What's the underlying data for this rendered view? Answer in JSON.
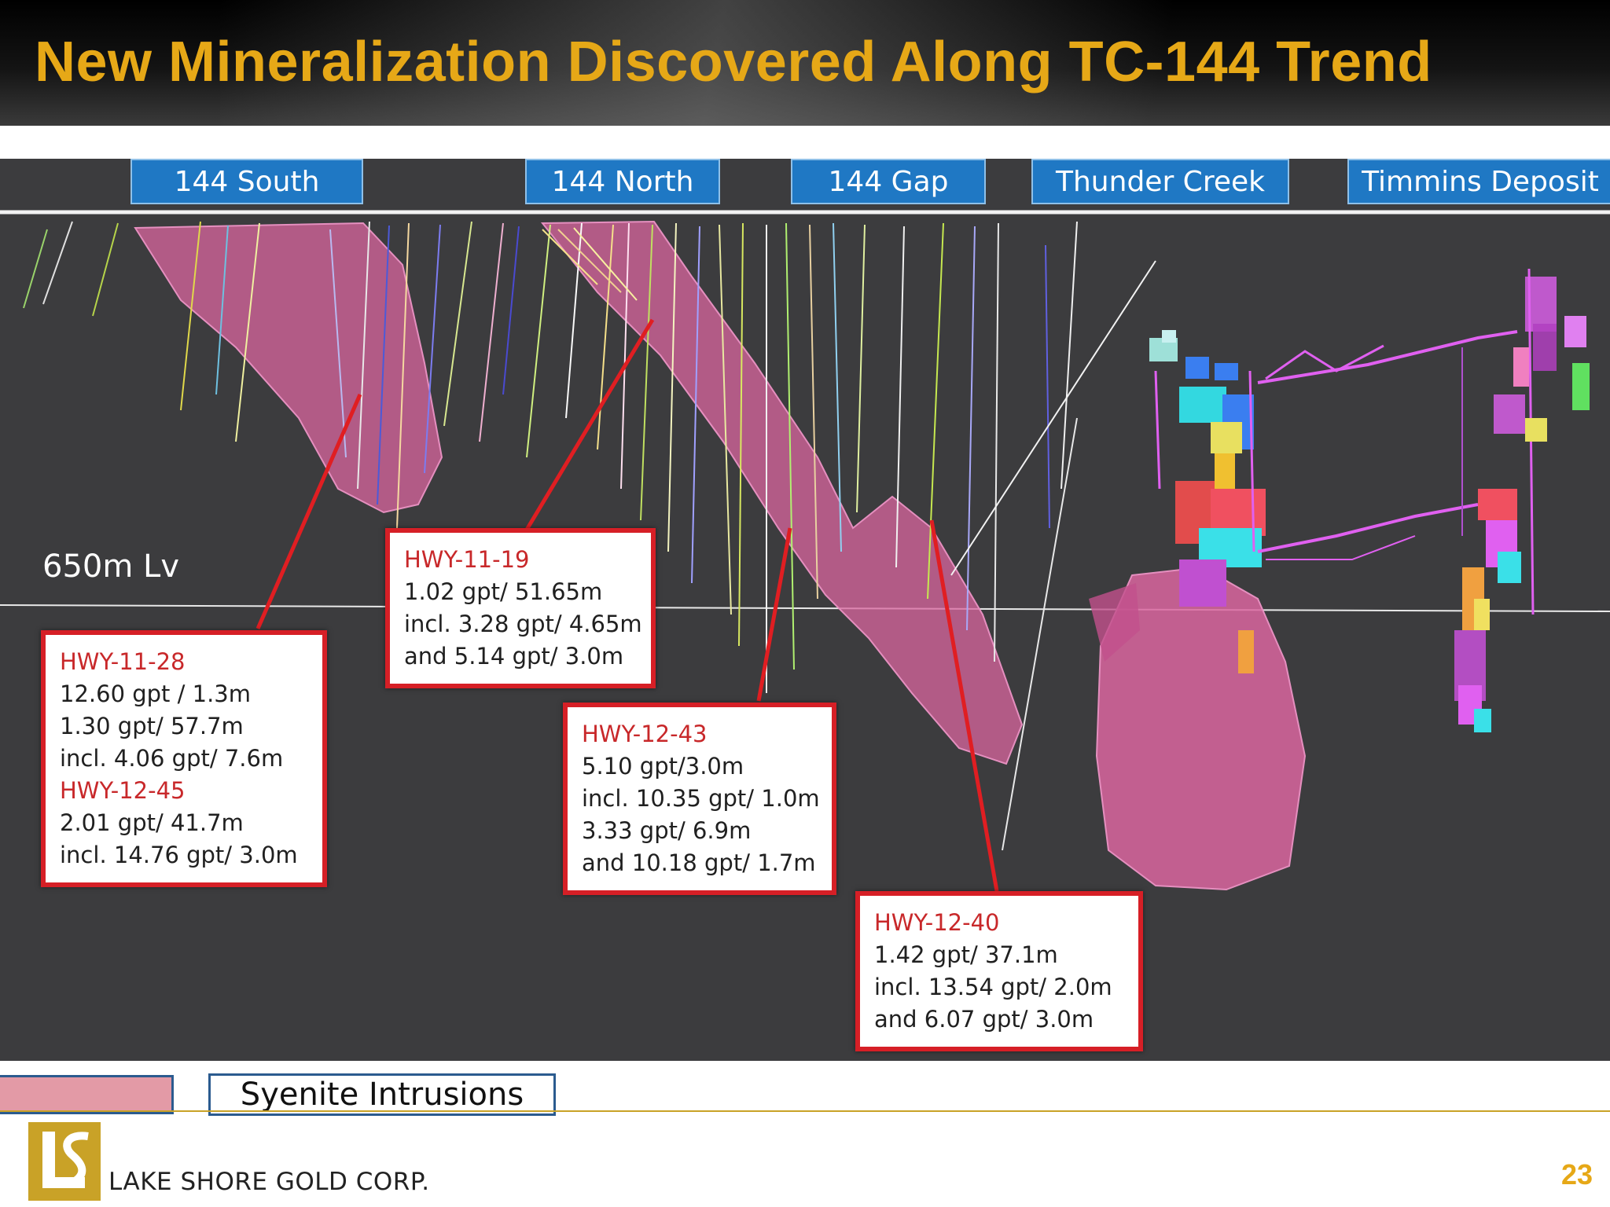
{
  "slide": {
    "title": "New Mineralization Discovered Along TC-144 Trend",
    "page_number": "23"
  },
  "diagram": {
    "zones": [
      "144 South",
      "144 North",
      "144 Gap",
      "Thunder Creek",
      "Timmins Deposit"
    ],
    "level_label": "650m Lv",
    "callouts": [
      {
        "holes": [
          {
            "id": "HWY-11-28",
            "intercepts": [
              "12.60 gpt / 1.3m",
              "1.30 gpt/ 57.7m",
              "incl. 4.06 gpt/ 7.6m"
            ]
          },
          {
            "id": "HWY-12-45",
            "intercepts": [
              "2.01 gpt/ 41.7m",
              "incl. 14.76 gpt/ 3.0m"
            ]
          }
        ]
      },
      {
        "holes": [
          {
            "id": "HWY-11-19",
            "intercepts": [
              "1.02 gpt/ 51.65m",
              "incl. 3.28 gpt/ 4.65m",
              "and 5.14 gpt/ 3.0m"
            ]
          }
        ]
      },
      {
        "holes": [
          {
            "id": "HWY-12-43",
            "intercepts": [
              "5.10 gpt/3.0m",
              "incl. 10.35 gpt/ 1.0m",
              "3.33 gpt/ 6.9m",
              "and 10.18 gpt/ 1.7m"
            ]
          }
        ]
      },
      {
        "holes": [
          {
            "id": "HWY-12-40",
            "intercepts": [
              "1.42 gpt/ 37.1m",
              "incl. 13.54 gpt/ 2.0m",
              "and 6.07 gpt/ 3.0m"
            ]
          }
        ]
      }
    ]
  },
  "legend": {
    "items": [
      {
        "label": "Syenite Intrusions",
        "color": "#e39aa6"
      }
    ]
  },
  "footer": {
    "company": "LAKE SHORE GOLD CORP."
  },
  "colors": {
    "title": "#e6a817",
    "diagram_background": "#3c3c3e",
    "zone_tab": "#1f78c4",
    "callout_border": "#d61f26",
    "hole_id": "#c8282a",
    "syenite": "#d9659f"
  }
}
